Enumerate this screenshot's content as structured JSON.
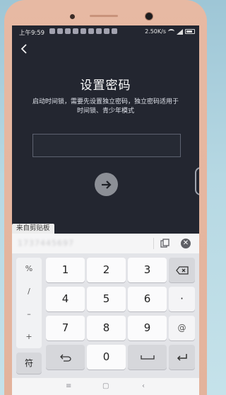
{
  "statusbar": {
    "time": "上午9:59",
    "speed": "2.50K/s",
    "battery": "41"
  },
  "page": {
    "title": "设置密码",
    "description": "启动时间锁，需要先设置独立密码，独立密码适用于时间锁、青少年模式"
  },
  "clipboard": {
    "tab_label": "来自剪贴板",
    "content": "1737445697"
  },
  "keyboard": {
    "symbols": [
      "%",
      "/",
      "–",
      "+"
    ],
    "symbols_label": "符",
    "digits_row1": [
      "1",
      "2",
      "3"
    ],
    "digits_row2": [
      "4",
      "5",
      "6"
    ],
    "digits_row3": [
      "7",
      "8",
      "9"
    ],
    "zero": "0",
    "dot": "·",
    "at": "@"
  },
  "colors": {
    "screen_bg": "#232630",
    "phone_body": "#e7b9a3",
    "keyboard_bg": "#e3e4e8"
  }
}
